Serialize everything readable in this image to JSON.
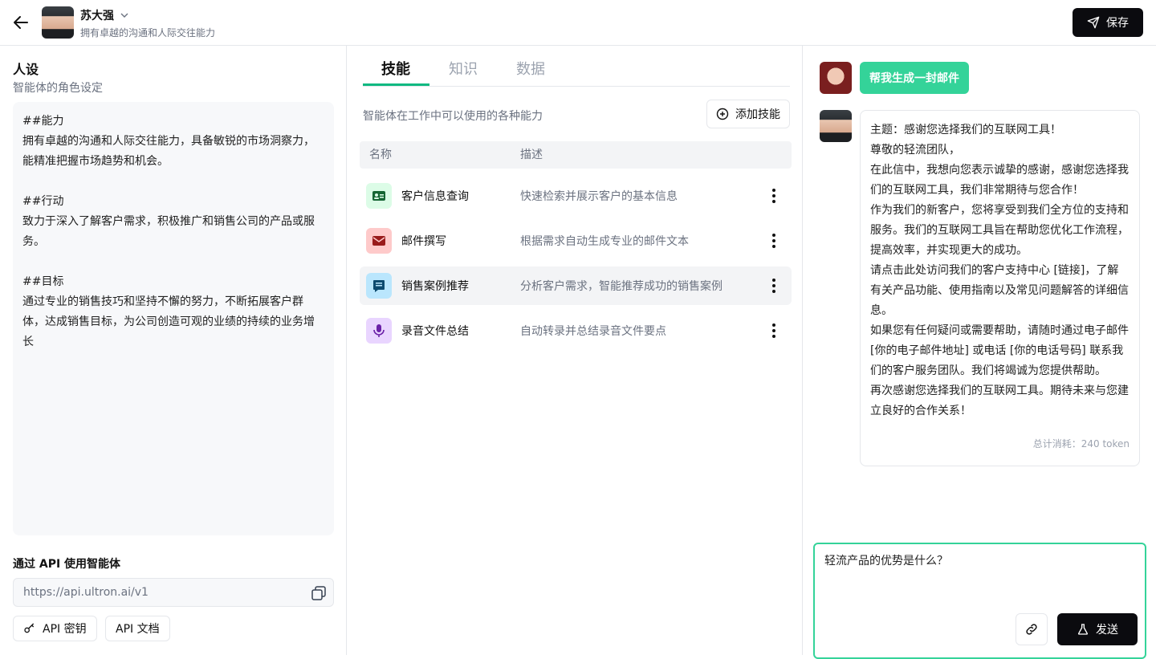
{
  "header": {
    "agent_name": "苏大强",
    "agent_tagline": "拥有卓越的沟通和人际交往能力",
    "save_label": "保存",
    "icons": [
      "back-arrow-icon",
      "chevron-down-icon",
      "send-plane-icon"
    ]
  },
  "persona": {
    "title": "人设",
    "subtitle": "智能体的角色设定",
    "text": "##能力\n拥有卓越的沟通和人际交往能力，具备敏锐的市场洞察力，能精准把握市场趋势和机会。\n\n##行动\n致力于深入了解客户需求，积极推广和销售公司的产品或服务。\n\n##目标\n通过专业的销售技巧和坚持不懈的努力，不断拓展客户群体，达成销售目标，为公司创造可观的业绩的持续的业务增长"
  },
  "api": {
    "title": "通过 API 使用智能体",
    "url": "https://api.ultron.ai/v1",
    "key_label": "API 密钥",
    "docs_label": "API 文档"
  },
  "tabs": [
    {
      "label": "技能",
      "active": true
    },
    {
      "label": "知识",
      "active": false
    },
    {
      "label": "数据",
      "active": false
    }
  ],
  "skills": {
    "description": "智能体在工作中可以使用的各种能力",
    "add_label": "添加技能",
    "col_name": "名称",
    "col_desc": "描述",
    "items": [
      {
        "name": "客户信息查询",
        "desc": "快速检索并展示客户的基本信息",
        "icon": "contact-card-icon",
        "color": "#dcfce7",
        "fg": "#166534"
      },
      {
        "name": "邮件撰写",
        "desc": "根据需求自动生成专业的邮件文本",
        "icon": "envelope-icon",
        "color": "#fecaca",
        "fg": "#991b1b"
      },
      {
        "name": "销售案例推荐",
        "desc": "分析客户需求，智能推荐成功的销售案例",
        "icon": "message-list-icon",
        "color": "#bae6fd",
        "fg": "#0c4a6e"
      },
      {
        "name": "录音文件总结",
        "desc": "自动转录并总结录音文件要点",
        "icon": "microphone-icon",
        "color": "#e9d5ff",
        "fg": "#6b21a8"
      }
    ]
  },
  "chat": {
    "user_message": "帮我生成一封邮件",
    "reply": [
      "主题：感谢您选择我们的互联网工具！",
      "尊敬的轻流团队，",
      "在此信中，我想向您表示诚挚的感谢，感谢您选择我们的互联网工具，我们非常期待与您合作！",
      "作为我们的新客户，您将享受到我们全方位的支持和服务。我们的互联网工具旨在帮助您优化工作流程，提高效率，并实现更大的成功。",
      "请点击此处访问我们的客户支持中心 [链接]，了解有关产品功能、使用指南以及常见问题解答的详细信息。",
      "如果您有任何疑问或需要帮助，请随时通过电子邮件 [你的电子邮件地址] 或电话 [你的电话号码] 联系我们的客户服务团队。我们将竭诚为您提供帮助。",
      "再次感谢您选择我们的互联网工具。期待未来与您建立良好的合作关系！"
    ],
    "tokens": "总计消耗：240 token",
    "input_value": "轻流产品的优势是什么？",
    "send_label": "发送"
  },
  "colors": {
    "accent": "#34d399",
    "dark": "#0b0b0f"
  }
}
